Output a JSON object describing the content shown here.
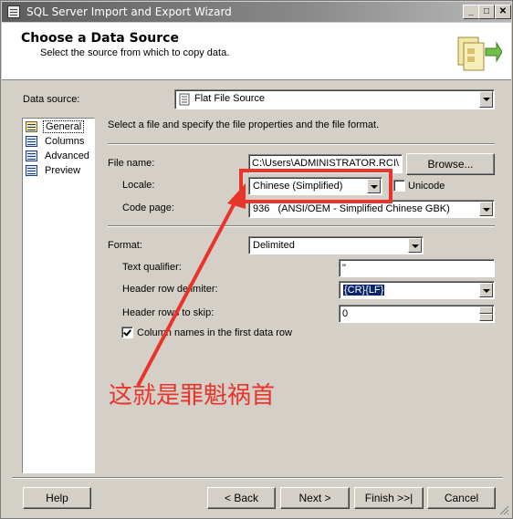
{
  "window": {
    "title": "SQL Server Import and Export Wizard",
    "controls": {
      "minimize": "_",
      "maximize": "□",
      "close": "✕"
    }
  },
  "header": {
    "title": "Choose a Data Source",
    "subtitle": "Select the source from which to copy data."
  },
  "data_source": {
    "label": "Data source:",
    "value": "Flat File Source"
  },
  "nav": {
    "items": [
      {
        "label": "General",
        "icon": "general-icon",
        "selected": true
      },
      {
        "label": "Columns",
        "icon": "columns-icon",
        "selected": false
      },
      {
        "label": "Advanced",
        "icon": "advanced-icon",
        "selected": false
      },
      {
        "label": "Preview",
        "icon": "preview-icon",
        "selected": false
      }
    ]
  },
  "general": {
    "description": "Select a file and specify the file properties and the file format.",
    "file_name_label": "File name:",
    "file_name_value": "C:\\Users\\ADMINISTRATOR.RCI\\",
    "browse_label": "Browse...",
    "locale_label": "Locale:",
    "locale_value": "Chinese (Simplified)",
    "unicode_label": "Unicode",
    "code_page_label": "Code page:",
    "code_page_value": "936   (ANSI/OEM - Simplified Chinese GBK)",
    "format_label": "Format:",
    "format_value": "Delimited",
    "text_qualifier_label": "Text qualifier:",
    "text_qualifier_value": "\"",
    "header_row_delimiter_label": "Header row delimiter:",
    "header_row_delimiter_value": "{CR}{LF}",
    "header_rows_to_skip_label": "Header rows to skip:",
    "header_rows_to_skip_value": "0",
    "column_names_label": "Column names in the first data row",
    "column_names_checked": true,
    "unicode_checked": false
  },
  "annotation": {
    "text": "这就是罪魁祸首",
    "color": "#e8342a"
  },
  "buttons": {
    "help": "Help",
    "back": "< Back",
    "next": "Next >",
    "finish": "Finish >>|",
    "cancel": "Cancel"
  }
}
